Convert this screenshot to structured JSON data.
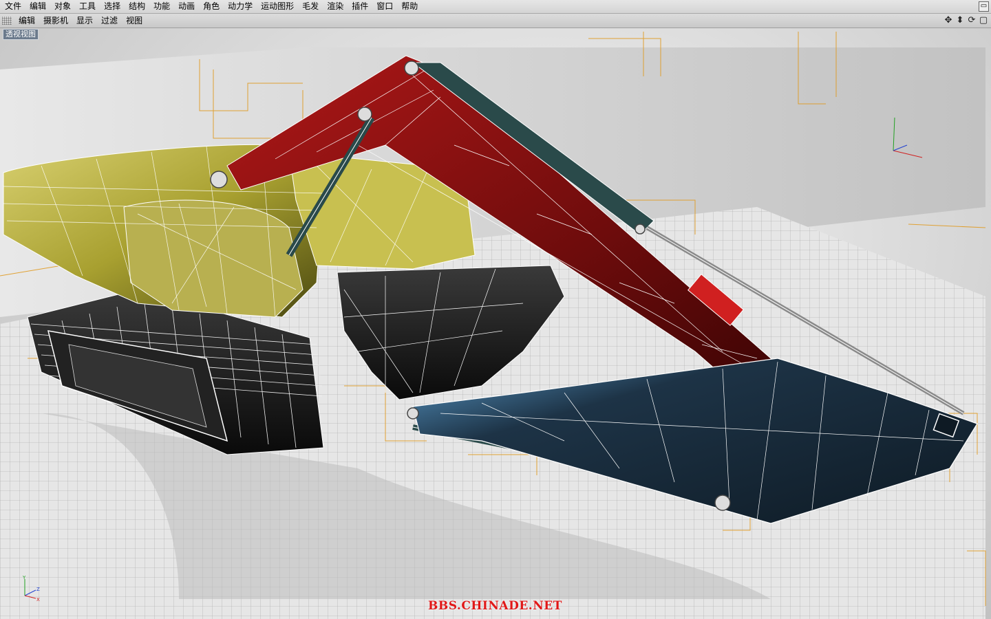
{
  "menu": {
    "items": [
      "文件",
      "编辑",
      "对象",
      "工具",
      "选择",
      "结构",
      "功能",
      "动画",
      "角色",
      "动力学",
      "运动图形",
      "毛发",
      "渲染",
      "插件",
      "窗口",
      "帮助"
    ]
  },
  "viewport_menu": {
    "items": [
      "编辑",
      "摄影机",
      "显示",
      "过滤",
      "视图"
    ]
  },
  "viewport": {
    "label": "透视视图"
  },
  "watermark": "BBS.CHINADE.NET",
  "icons": [
    "move-view-icon",
    "zoom-view-icon",
    "rotate-view-icon",
    "maximize-view-icon",
    "close-window-icon"
  ],
  "colors": {
    "boom_red": "#8c1212",
    "arm_blue": "#1d3346",
    "body_yellow": "#a8a030",
    "wire": "#ffffff",
    "bone_orange": "#e09a20",
    "grid": "#9a9a9a"
  }
}
